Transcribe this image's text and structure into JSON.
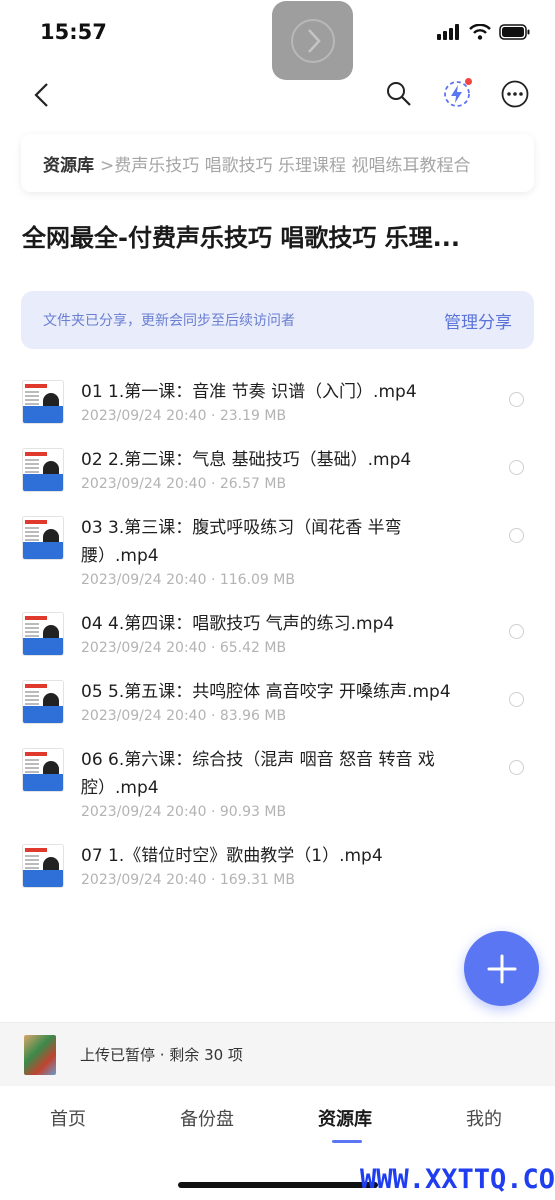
{
  "status": {
    "time": "15:57"
  },
  "breadcrumb": {
    "root": "资源库",
    "path": ">费声乐技巧 唱歌技巧 乐理课程 视唱练耳教程合"
  },
  "title": "全网最全-付费声乐技巧 唱歌技巧 乐理...",
  "share": {
    "text": "文件夹已分享，更新会同步至后续访问者",
    "action": "管理分享"
  },
  "files": [
    {
      "name": "01 1.第一课：音准 节奏 识谱（入门）.mp4",
      "meta": "2023/09/24 20:40 · 23.19 MB"
    },
    {
      "name": "02 2.第二课：气息 基础技巧（基础）.mp4",
      "meta": "2023/09/24 20:40 · 26.57 MB"
    },
    {
      "name": "03 3.第三课：腹式呼吸练习（闻花香 半弯腰）.mp4",
      "meta": "2023/09/24 20:40 · 116.09 MB"
    },
    {
      "name": "04 4.第四课：唱歌技巧 气声的练习.mp4",
      "meta": "2023/09/24 20:40 · 65.42 MB"
    },
    {
      "name": "05 5.第五课：共鸣腔体 高音咬字 开嗓练声.mp4",
      "meta": "2023/09/24 20:40 · 83.96 MB"
    },
    {
      "name": "06 6.第六课：综合技（混声 咽音 怒音 转音 戏腔）.mp4",
      "meta": "2023/09/24 20:40 · 90.93 MB"
    },
    {
      "name": "07 1.《错位时空》歌曲教学（1）.mp4",
      "meta": "2023/09/24 20:40 · 169.31 MB"
    }
  ],
  "upload": {
    "text": "上传已暂停 · 剩余 30 项"
  },
  "tabs": [
    {
      "label": "首页"
    },
    {
      "label": "备份盘"
    },
    {
      "label": "资源库"
    },
    {
      "label": "我的"
    }
  ],
  "watermark": "WWW.XXTTQ.COM",
  "colors": {
    "accent": "#5b76f2",
    "banner_bg": "#e8ecfb",
    "badge": "#f0463f"
  }
}
